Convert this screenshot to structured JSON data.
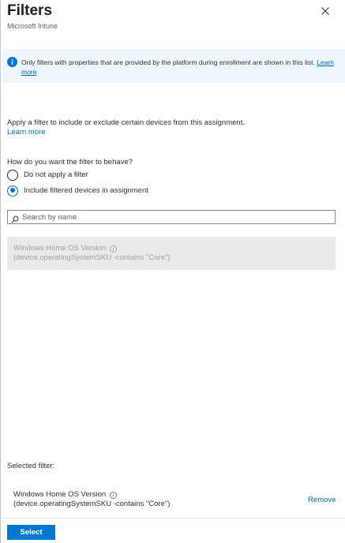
{
  "header": {
    "title": "Filters",
    "subtitle": "Microsoft Intune",
    "close_icon": "close-icon"
  },
  "info_bar": {
    "icon": "info-icon",
    "text": "Only filters with properties that are provided by the platform during enrollment are shown in this list.",
    "link": "Learn more",
    "background": "#eff6fc",
    "icon_color": "#0078d4"
  },
  "description": {
    "text": "Apply a filter to include or exclude certain devices from this assignment.",
    "link": "Learn more"
  },
  "behavior": {
    "question": "How do you want the filter to behave?",
    "options": [
      {
        "label": "Do not apply a filter",
        "checked": false
      },
      {
        "label": "Include filtered devices in assignment",
        "checked": true
      }
    ]
  },
  "search": {
    "placeholder": "Search by name",
    "value": ""
  },
  "filters": [
    {
      "name": "Windows Home OS Version",
      "rule": "(device.operatingSystemSKU -contains \"Core\")"
    }
  ],
  "selected": {
    "label": "Selected filter:",
    "name": "Windows Home OS Version",
    "rule": "(device.operatingSystemSKU -contains \"Core\")",
    "remove_label": "Remove"
  },
  "footer": {
    "select_label": "Select"
  },
  "colors": {
    "accent": "#0078d4",
    "link": "#0067b8"
  }
}
